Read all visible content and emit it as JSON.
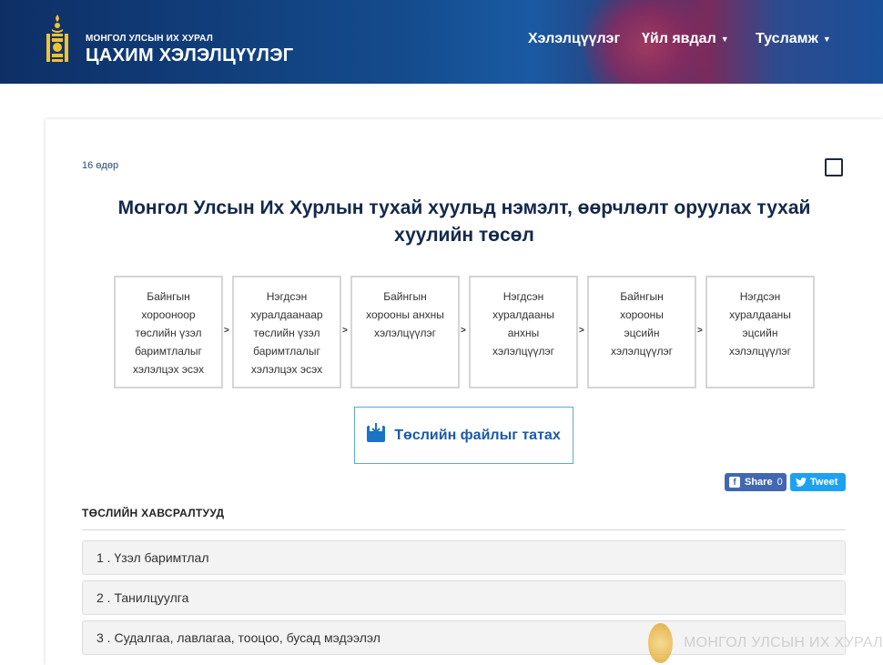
{
  "header": {
    "brand_top": "МОНГОЛ УЛСЫН ИХ ХУРАЛ",
    "brand_main": "ЦАХИМ ХЭЛЭЛЦҮҮЛЭГ",
    "nav": [
      {
        "label": "Хэлэлцүүлэг",
        "has_dropdown": false
      },
      {
        "label": "Үйл явдал",
        "has_dropdown": true
      },
      {
        "label": "Тусламж",
        "has_dropdown": true
      }
    ]
  },
  "bill": {
    "days_left": "16 өдөр",
    "title": "Монгол Улсын Их Хурлын тухай хуульд нэмэлт, өөрчлөлт оруулах тухай хуулийн төсөл"
  },
  "steps": [
    {
      "label": "Байнгын хорооноор төслийн үзэл баримтлалыг хэлэлцэх эсэх"
    },
    {
      "label": "Нэгдсэн хуралдаанаар төслийн үзэл баримтлалыг хэлэлцэх эсэх"
    },
    {
      "label": "Байнгын хорооны анхны хэлэлцүүлэг"
    },
    {
      "label": "Нэгдсэн хуралдааны анхны хэлэлцүүлэг"
    },
    {
      "label": "Байнгын хорооны эцсийн хэлэлцүүлэг"
    },
    {
      "label": "Нэгдсэн хуралдааны эцсийн хэлэлцүүлэг"
    }
  ],
  "step_separator": ">",
  "download": {
    "label": "Төслийн файлыг татах"
  },
  "share": {
    "facebook_label": "Share",
    "facebook_count": "0",
    "twitter_label": "Tweet"
  },
  "attachments": {
    "title": "ТӨСЛИЙН ХАВСРАЛТУУД",
    "items": [
      {
        "label": "1 . Үзэл баримтлал"
      },
      {
        "label": "2 . Танилцуулга"
      },
      {
        "label": "3 . Судалгаа, лавлагаа, тооцоо, бусад мэдээлэл"
      }
    ]
  },
  "watermark": {
    "text": "МОНГОЛ УЛСЫН ИХ ХУРАЛ"
  },
  "colors": {
    "header_bg": "#144b8c",
    "title": "#13284b",
    "accent": "#1a5aa8",
    "facebook": "#4267b2",
    "twitter": "#1da1f2"
  },
  "icons": [
    "soyombo-logo-icon",
    "caret-down-icon",
    "download-icon",
    "facebook-icon",
    "twitter-icon",
    "seal-icon"
  ]
}
